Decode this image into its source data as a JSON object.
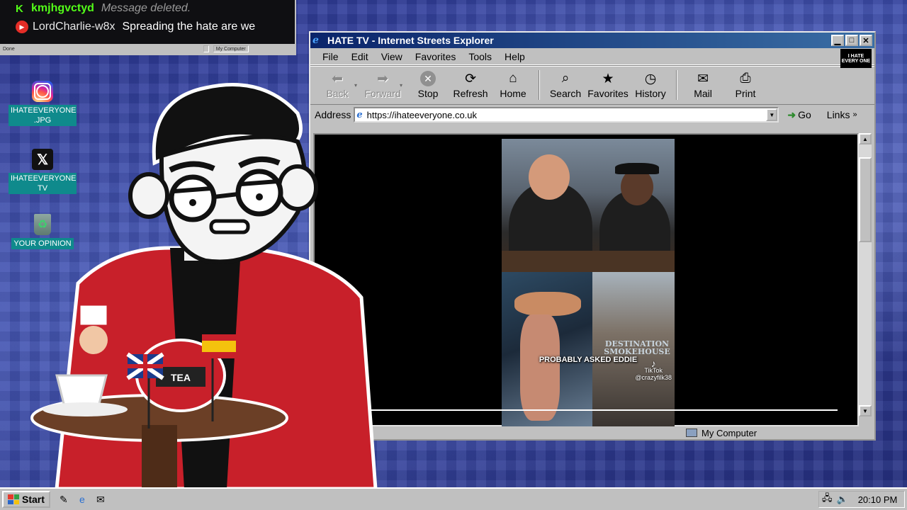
{
  "chat": {
    "messages": [
      {
        "platform_icon": "kick-icon",
        "user": "kmjhgvctyd",
        "text": "Message deleted."
      },
      {
        "platform_icon": "youtube-icon",
        "user": "LordCharlie-w8x",
        "text": "Spreading the hate are we"
      }
    ],
    "status_left": "Done",
    "status_right": "My Computer"
  },
  "desktop": {
    "icons": [
      {
        "icon": "instagram-icon",
        "label": "IHATEEVERYONE .JPG"
      },
      {
        "icon": "x-logo-icon",
        "label": "IHATEEVERYONE TV"
      },
      {
        "icon": "recycle-bin-icon",
        "label": "YOUR OPINION"
      }
    ]
  },
  "browser": {
    "title": "HATE TV - Internet Streets Explorer",
    "menu": [
      "File",
      "Edit",
      "View",
      "Favorites",
      "Tools",
      "Help"
    ],
    "brand_logo": "I HATE EVERY ONE",
    "toolbar": {
      "back": "Back",
      "forward": "Forward",
      "stop": "Stop",
      "refresh": "Refresh",
      "home": "Home",
      "search": "Search",
      "favorites": "Favorites",
      "history": "History",
      "mail": "Mail",
      "print": "Print"
    },
    "address_label": "Address",
    "url": "https://ihateeveryone.co.uk",
    "go": "Go",
    "links": "Links",
    "status_zone": "My Computer"
  },
  "video": {
    "caption": "PROBABLY ASKED EDDIE",
    "sign": "DESTINATION SMOKEHOUSE",
    "watermark_brand": "TikTok",
    "watermark_user": "@crazyfilk38"
  },
  "taskbar": {
    "start": "Start",
    "clock": "20:10 PM"
  },
  "colors": {
    "titlebar_start": "#0a246a",
    "titlebar_end": "#3a6ea5",
    "desktop_label_bg": "#0f8a8c",
    "chat_kick_green": "#53fc18"
  }
}
